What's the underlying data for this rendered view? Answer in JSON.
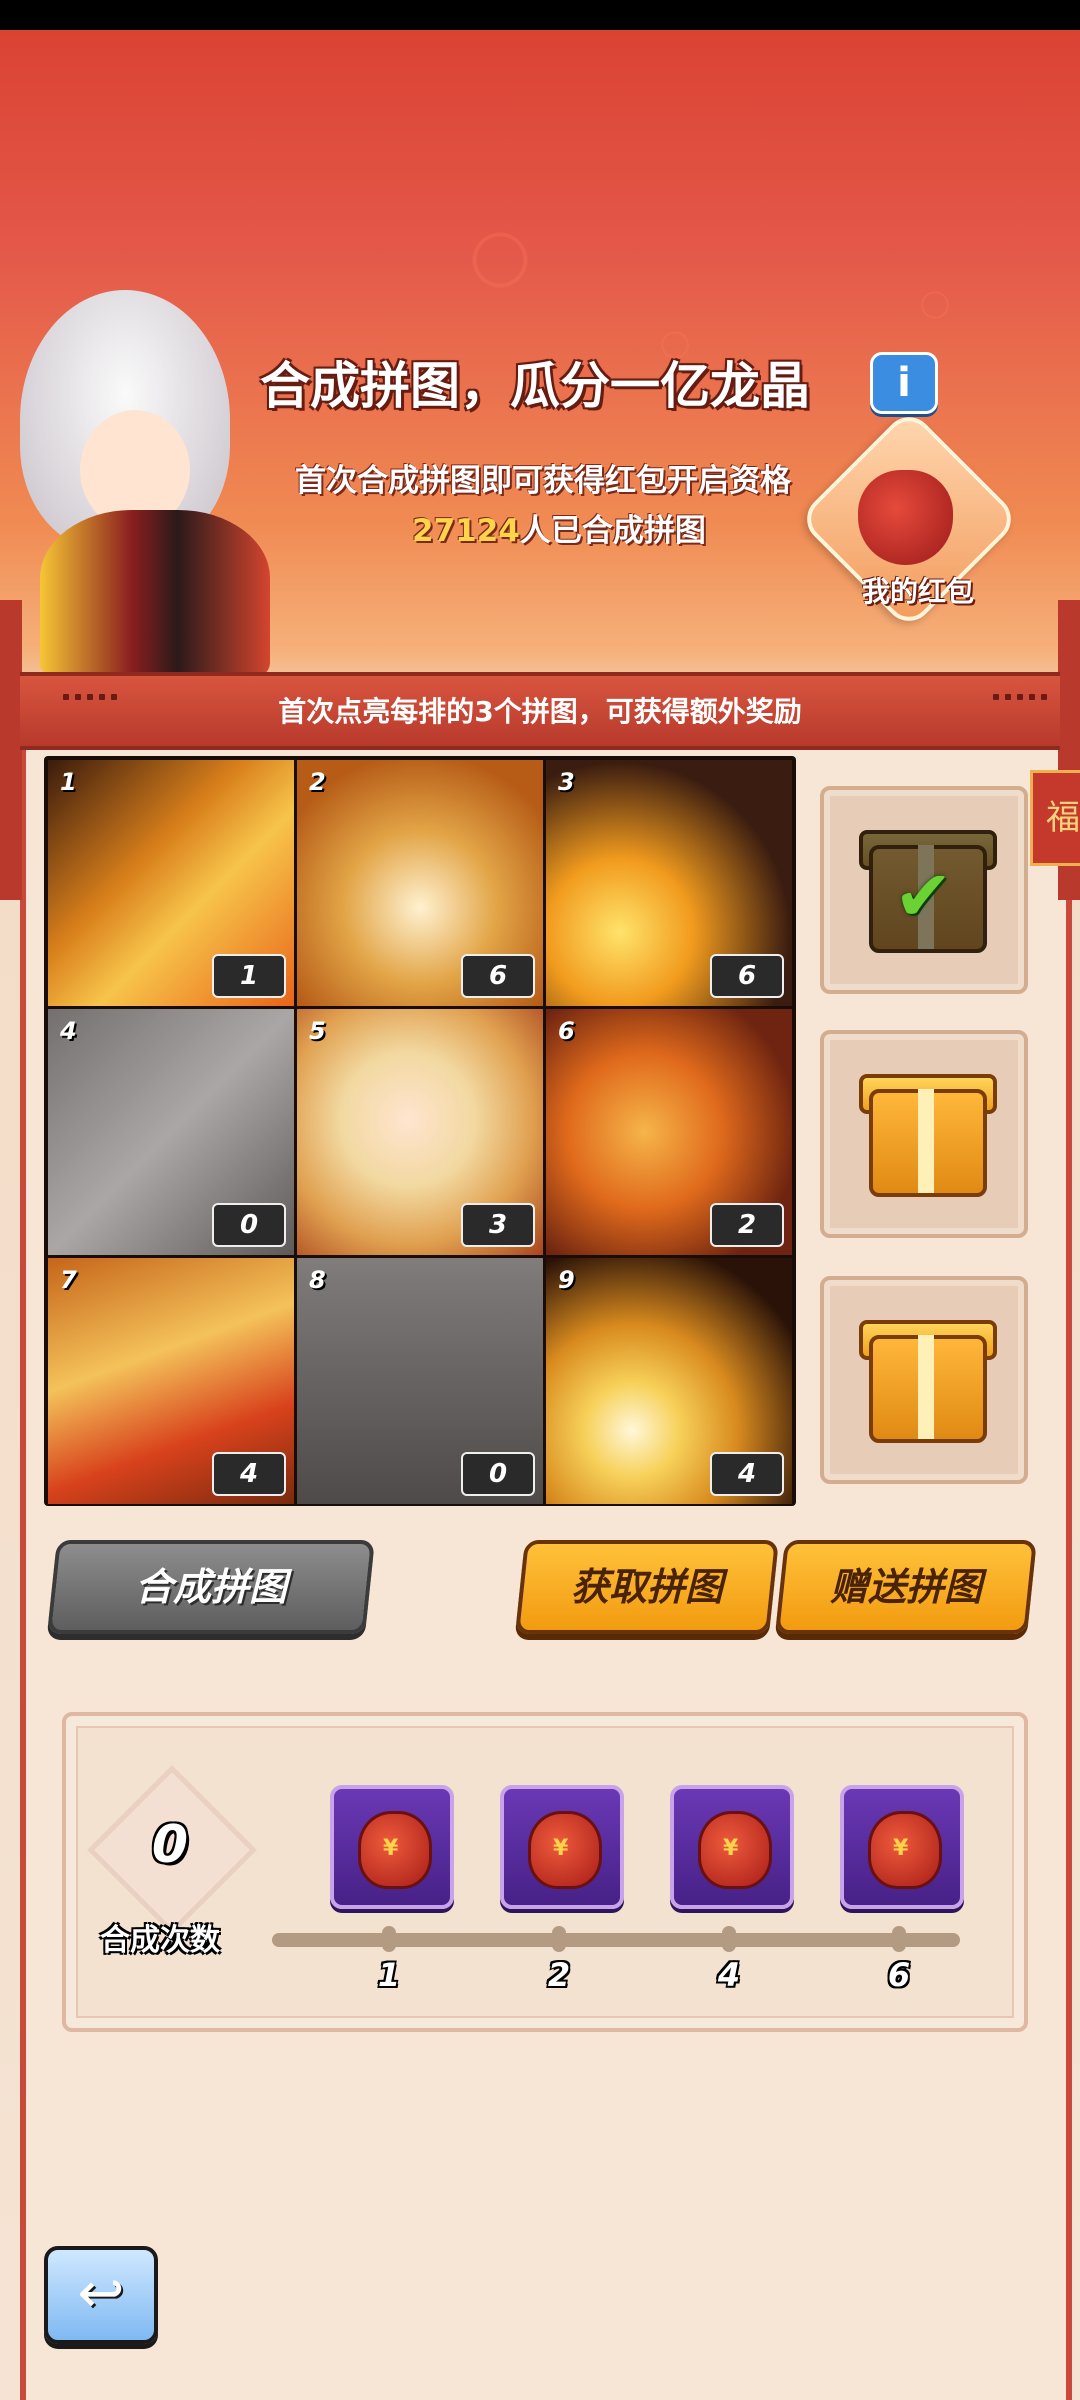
{
  "header": {
    "title": "合成拼图，瓜分一亿龙晶",
    "info_icon": "i",
    "subtitle": "首次合成拼图即可获得红包开启资格",
    "count_value": "27124",
    "count_suffix": "人已合成拼图",
    "my_redpack_label": "我的红包"
  },
  "banner": {
    "text": "首次点亮每排的3个拼图，可获得额外奖励"
  },
  "side_sign": "福",
  "puzzle": {
    "pieces": [
      {
        "index": "1",
        "count": "1",
        "owned": true
      },
      {
        "index": "2",
        "count": "6",
        "owned": true
      },
      {
        "index": "3",
        "count": "6",
        "owned": true
      },
      {
        "index": "4",
        "count": "0",
        "owned": false
      },
      {
        "index": "5",
        "count": "3",
        "owned": true
      },
      {
        "index": "6",
        "count": "2",
        "owned": true
      },
      {
        "index": "7",
        "count": "4",
        "owned": true
      },
      {
        "index": "8",
        "count": "0",
        "owned": false
      },
      {
        "index": "9",
        "count": "4",
        "owned": true
      }
    ]
  },
  "row_rewards": [
    {
      "icon": "gift-box-icon",
      "claimed": true
    },
    {
      "icon": "gift-box-icon",
      "claimed": false
    },
    {
      "icon": "gift-box-icon",
      "claimed": false
    }
  ],
  "buttons": {
    "combine": "合成拼图",
    "get": "获取拼图",
    "gift": "赠送拼图"
  },
  "progress": {
    "times_value": "0",
    "times_label": "合成次数",
    "milestones": [
      "1",
      "2",
      "4",
      "6"
    ],
    "reward_icon": "red-envelope-bag-icon"
  },
  "back_icon": "back-arrow-icon",
  "colors": {
    "banner_red": "#c0402f",
    "button_orange": "#f5a623",
    "button_gray": "#707070",
    "reward_purple": "#5b2c9f"
  }
}
